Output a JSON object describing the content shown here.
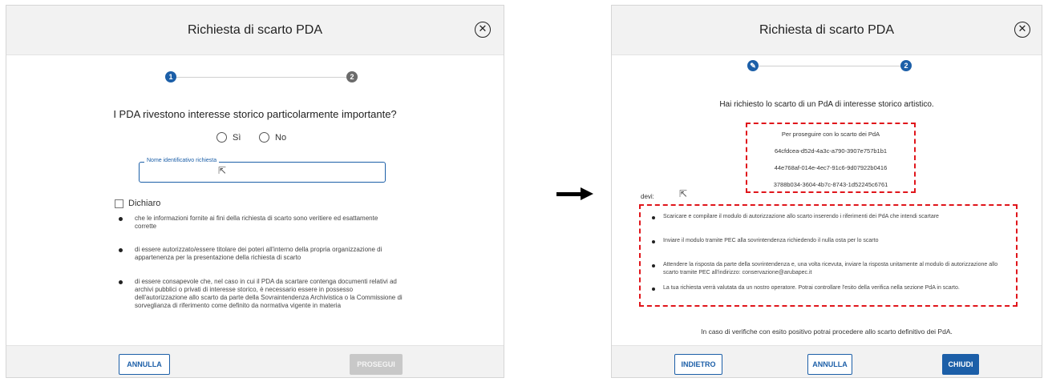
{
  "left_modal": {
    "title": "Richiesta di scarto PDA",
    "close_glyph": "✕",
    "steps": [
      "1",
      "2"
    ],
    "question": "I PDA rivestono interesse storico particolarmente importante?",
    "radio_yes": "Sì",
    "radio_no": "No",
    "input_label": "Nome identificativo richiesta",
    "input_value": "",
    "checkbox_label": "Dichiaro",
    "bullets": [
      "che le informazioni fornite ai fini della richiesta di scarto sono veritiere ed esattamente corrette",
      "di essere autorizzato/essere titolare dei poteri all'interno della propria organizzazione di appartenenza per la presentazione della richiesta di scarto",
      "di essere consapevole che, nel caso in cui il PDA da scartare contenga documenti relativi ad archivi pubblici o privati di interesse storico, è necessario essere in possesso dell'autorizzazione allo scarto da parte della Sovraintendenza Archivistica o la Commissione di sorveglianza di riferimento come definito da normativa vigente in materia"
    ],
    "cancel_label": "ANNULLA",
    "proceed_label": "PROSEGUI"
  },
  "right_modal": {
    "title": "Richiesta di scarto PDA",
    "close_glyph": "✕",
    "step1_icon": "pencil-icon",
    "steps": [
      "2"
    ],
    "heading": "Hai richiesto lo scarto di un PdA di interesse storico artistico.",
    "proceed_intro": "Per proseguire con lo scarto dei PdA",
    "uuids": [
      "64cfdcea-d52d-4a3c-a790-3907e757b1b1",
      "44e768af-014e-4ec7-91c6-9d07922b0416",
      "3788b034-3604-4b7c-8743-1d52245c6761"
    ],
    "devi_label": "devi:",
    "instructions": [
      "Scaricare e compilare il modulo di autorizzazione allo scarto inserendo i riferimenti dei PdA che intendi scartare",
      "Inviare il modulo tramite PEC alla sovrintendenza richiedendo il nulla osta per lo scarto",
      "Attendere la risposta da parte della sovrintendenza e, una volta ricevuta, inviare la risposta unitamente al modulo di autorizzazione allo scarto tramite PEC all'indirizzo: conservazione@arubapec.it",
      "La tua richiesta verrà valutata da un nostro operatore. Potrai controllare l'esito della verifica nella sezione PdA in scarto."
    ],
    "footer_note": "In caso di verifiche con esito positivo potrai procedere allo scarto definitivo dei PdA.",
    "back_label": "INDIETRO",
    "cancel_label": "ANNULLA",
    "close_label": "CHIUDI"
  },
  "colors": {
    "primary": "#1c5fa8",
    "highlight": "#e0151b",
    "step_inactive": "#6b6b6b",
    "header_bg": "#f2f2f2"
  }
}
